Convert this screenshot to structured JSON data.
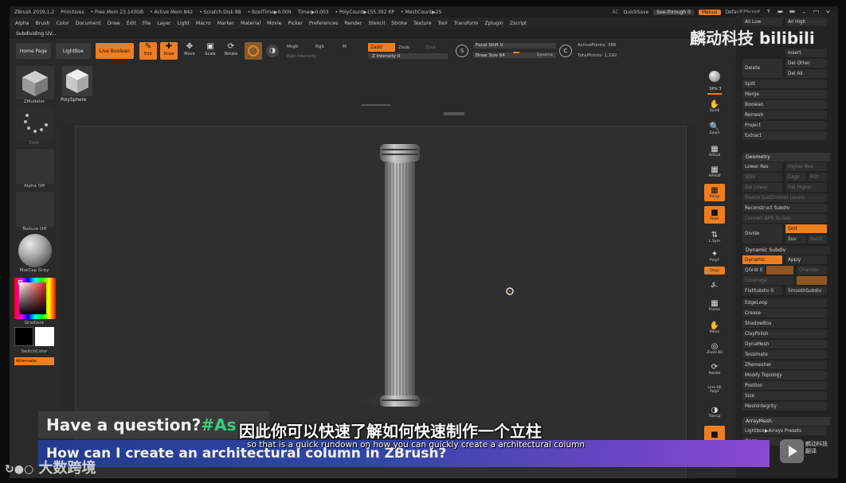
{
  "titlebar": {
    "items": [
      "ZBrush 2019.1.2",
      "Primitives",
      "• Free Mem 23.143GB",
      "• Active Mem 842",
      "• Scratch Disk 88",
      "• BoolTime▶0.009",
      "Timer▶0.003",
      "• PolyCount▶155.392 KP",
      "• MeshCount▶25"
    ],
    "ac": "AC",
    "quicksave": "QuickSave",
    "see_through": "See-through 0",
    "menus": "Menus",
    "script": "DefaultZScript"
  },
  "menubar": [
    "Alpha",
    "Brush",
    "Color",
    "Document",
    "Draw",
    "Edit",
    "File",
    "Layer",
    "Light",
    "Macro",
    "Marker",
    "Material",
    "Movie",
    "Picker",
    "Preferences",
    "Render",
    "Stencil",
    "Stroke",
    "Texture",
    "Tool",
    "Transform",
    "Zplugin",
    "Zscript"
  ],
  "subbar": {
    "label": "Subdividing UV..."
  },
  "toolbar": {
    "home": "Home Page",
    "lightbox": "LightBox",
    "live_boolean": "Live Boolean",
    "edit": "Edit",
    "draw": "Draw",
    "move": "Move",
    "scale": "Scale",
    "rotate": "Rotate",
    "mrgb": "Mrgb",
    "rgb": "Rgb",
    "m": "M",
    "rgb_intensity": "Rgb Intensity",
    "zadd": "Zadd",
    "zsub": "Zsub",
    "zcut": "Zcut",
    "z_intensity": "Z Intensity 0",
    "focal_shift": "Focal Shift 0",
    "draw_size": "Draw Size 64",
    "dynamic": "Dynamic",
    "active_points": "ActivePoints: 386",
    "total_points": "TotalPoints: 1,192"
  },
  "leftshelf": {
    "zmodeler": "ZModeler",
    "dots": "Dots",
    "alpha_off": "Alpha Off",
    "texture_off": "Texture Off",
    "matcap": "MatCap Gray",
    "gradient": "Gradient",
    "switchcolor": "SwitchColor",
    "alternate": "Alternate"
  },
  "tools": {
    "polysphere": "PolySphere"
  },
  "rightshelf": {
    "spix": "SPix 3",
    "scroll": "Scroll",
    "zoom": "Zoom",
    "actual": "Actual",
    "aahalf": "AAHalf",
    "persp": "Persp",
    "floor": "Floor",
    "lsym": "L.Sym",
    "poly": "PolyF",
    "xyz": "Qxyz",
    "frame": "Frame",
    "move": "Move",
    "zoom3d": "Zoom3D",
    "rotate": "Rotate",
    "linefill": "Line Fill PolyF",
    "transp": "Transp"
  },
  "toolpanel": {
    "all_low": "All Low",
    "all_high": "All High",
    "insert": "Insert",
    "delete": "Delete",
    "del_other": "Del Other",
    "del_all": "Del All",
    "split": "Split",
    "merge": "Merge",
    "boolean": "Boolean",
    "remesh": "Remesh",
    "project": "Project",
    "extract": "Extract",
    "geometry": "Geometry",
    "lower_res": "Lower Res",
    "higher_res": "Higher Res",
    "sdiv": "SDiv",
    "cage": "Cage",
    "rstr": "Rstr",
    "del_lower": "Del Lower",
    "del_higher": "Del Higher",
    "freeze_subdiv": "Freeze SubDivision Levels",
    "reconstruct": "Reconstruct Subdiv",
    "convert_bpr": "Convert BPR To Geo",
    "divide": "Divide",
    "smt": "Smt",
    "suv": "Suv",
    "reuv": "ReUV",
    "dynamic_subdiv": "Dynamic Subdiv",
    "dynamic": "Dynamic",
    "apply": "Apply",
    "qgrid": "QGrid 0",
    "chamfer": "Chamfer",
    "coverage": "Coverage",
    "flatsubdiv": "FlatSubdiv 0",
    "smoothsubdiv": "SmoothSubdiv",
    "edgeloop": "EdgeLoop",
    "crease": "Crease",
    "shadowbox": "ShadowBox",
    "claypolish": "ClayPolish",
    "dynamesh": "DynaMesh",
    "tessimate": "Tessimate",
    "zremesher": "ZRemesher",
    "modify_topology": "Modify Topology",
    "position": "Position",
    "size": "Size",
    "meshintegrity": "MeshIntegrity",
    "arraymesh": "ArrayMesh",
    "lightbox_arrays": "Lightbox▶Arrays Presets",
    "open": "Open"
  },
  "overlays": {
    "question_prefix": "Have a question? ",
    "question_hash": "#As",
    "bottom_question": "How can I create an architectural column in ZBrush?",
    "subtitle_cn": "因此你可以快速了解如何快速制作一个立柱",
    "subtitle_en": "so that is a quick rundown on how you can quickly create a architectural column",
    "watermark_top": "麟动科技 bilibili",
    "watermark_bottom_left": "大数跨境",
    "watermark_bottom_right": "麟动科技 翻译"
  },
  "colors": {
    "accent": "#ef7e1f",
    "ui_bg": "#282828",
    "panel_bg": "#232323",
    "banner_blue": "#3047a8",
    "banner_purple": "#8a4ad2",
    "hashtag_green": "#34d07a"
  }
}
